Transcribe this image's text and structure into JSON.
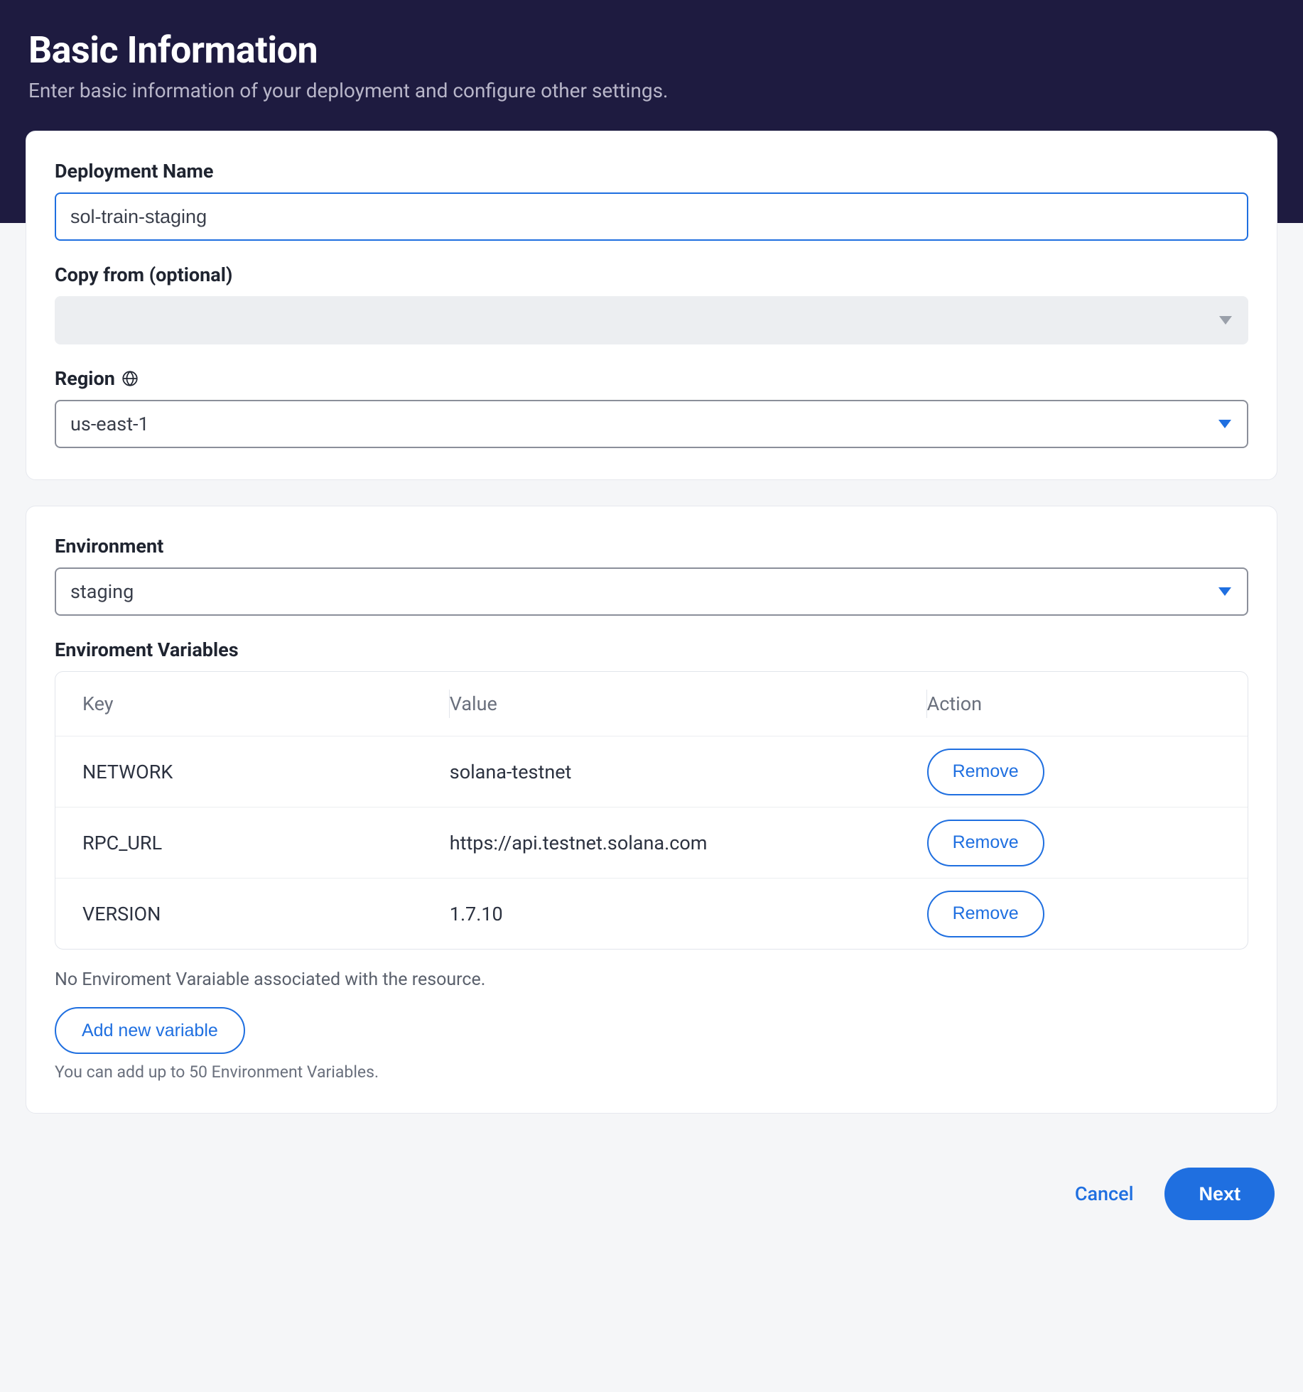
{
  "header": {
    "title": "Basic Information",
    "subtitle": "Enter basic information of your deployment and configure other settings."
  },
  "section1": {
    "name_label": "Deployment Name",
    "name_value": "sol-train-staging",
    "copy_label": "Copy from (optional)",
    "copy_value": "",
    "region_label": "Region",
    "region_value": "us-east-1"
  },
  "section2": {
    "env_label": "Environment",
    "env_value": "staging",
    "vars_label": "Enviroment Variables",
    "table": {
      "headers": {
        "key": "Key",
        "value": "Value",
        "action": "Action"
      },
      "rows": [
        {
          "key": "NETWORK",
          "value": "solana-testnet",
          "action": "Remove"
        },
        {
          "key": "RPC_URL",
          "value": "https://api.testnet.solana.com",
          "action": "Remove"
        },
        {
          "key": "VERSION",
          "value": "1.7.10",
          "action": "Remove"
        }
      ]
    },
    "empty_note": "No Enviroment Varaiable associated with the resource.",
    "add_button": "Add new variable",
    "hint": "You can add up to 50 Environment Variables."
  },
  "footer": {
    "cancel": "Cancel",
    "next": "Next"
  }
}
